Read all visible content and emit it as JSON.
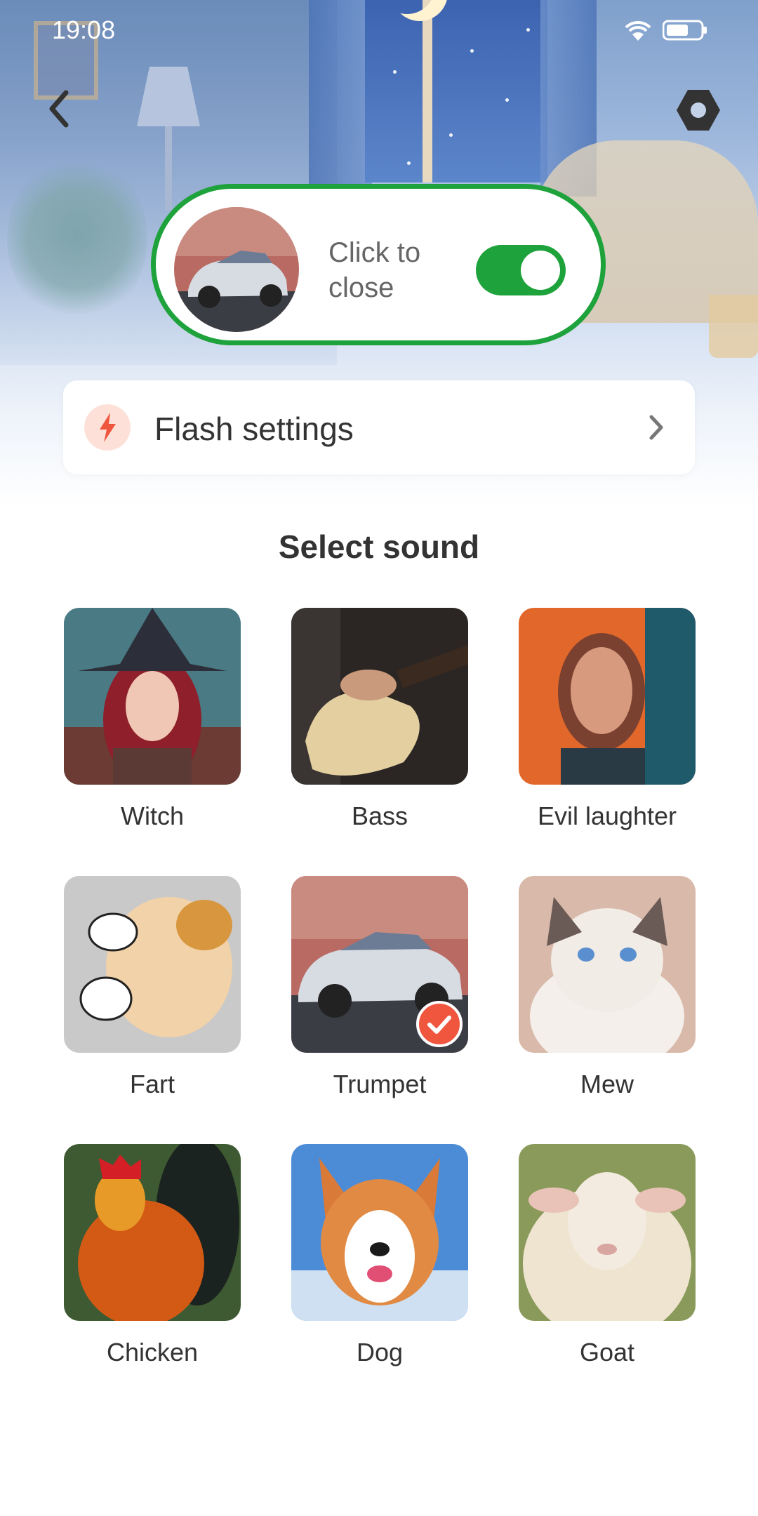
{
  "status_bar": {
    "time": "19:08"
  },
  "toggle_card": {
    "label": "Click to close",
    "enabled": true
  },
  "flash_settings": {
    "label": "Flash settings"
  },
  "sound_section": {
    "title": "Select sound",
    "selected": "Trumpet",
    "items": [
      {
        "label": "Witch"
      },
      {
        "label": "Bass"
      },
      {
        "label": "Evil laughter"
      },
      {
        "label": "Fart"
      },
      {
        "label": "Trumpet"
      },
      {
        "label": "Mew"
      },
      {
        "label": "Chicken"
      },
      {
        "label": "Dog"
      },
      {
        "label": "Goat"
      }
    ]
  },
  "colors": {
    "accent_green": "#1ea23b",
    "check_red": "#f0563e",
    "flash_orange": "#f0563e"
  }
}
